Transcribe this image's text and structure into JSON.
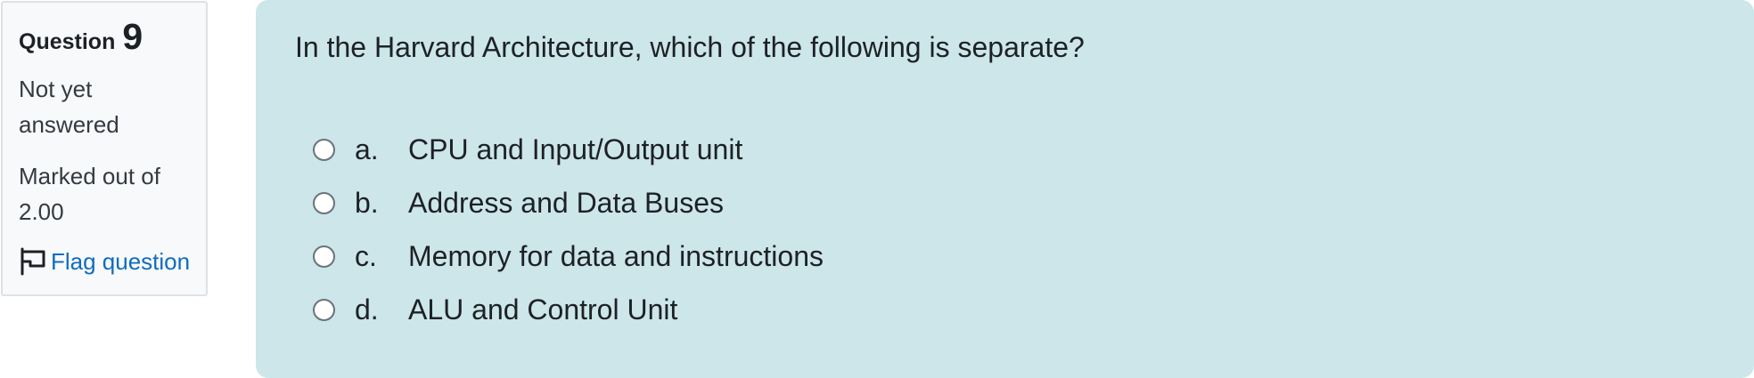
{
  "info": {
    "question_label": "Question",
    "question_number": "9",
    "state": "Not yet answered",
    "grade": "Marked out of 2.00",
    "flag_label": "Flag question",
    "flag_icon": "flag-outline-icon"
  },
  "question": {
    "text": "In the Harvard Architecture, which of the following is separate?",
    "answers": [
      {
        "letter": "a.",
        "text": "CPU and Input/Output unit",
        "selected": false
      },
      {
        "letter": "b.",
        "text": "Address and Data Buses",
        "selected": false
      },
      {
        "letter": "c.",
        "text": "Memory for data and instructions",
        "selected": false
      },
      {
        "letter": "d.",
        "text": "ALU and Control Unit",
        "selected": false
      }
    ]
  },
  "colors": {
    "content_background": "#cce6ea",
    "info_background": "#f8f9fa",
    "link": "#0f6cbf",
    "text": "#1d2125"
  }
}
